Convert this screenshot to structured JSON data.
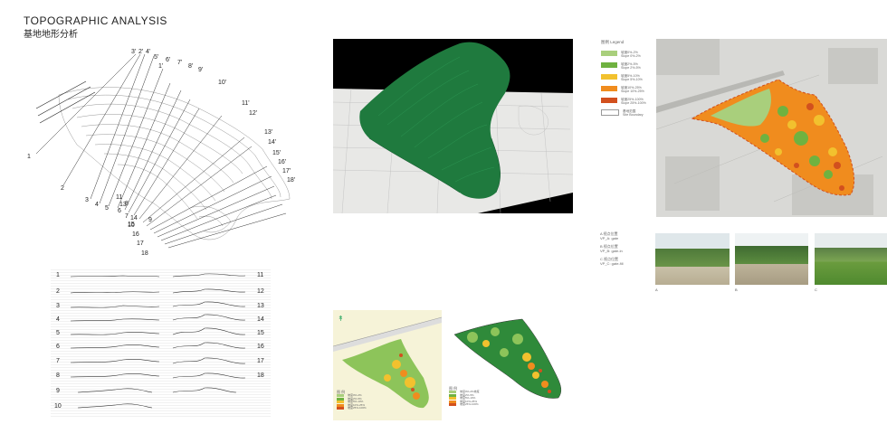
{
  "header": {
    "title": "TOPOGRAPHIC ANALYSIS",
    "subtitle": "基地地形分析"
  },
  "section_labels": {
    "top_primed": [
      "3'",
      "2'",
      "4'",
      "5'",
      "1'",
      "6'",
      "7'",
      "8'",
      "9'",
      "10'",
      "11'",
      "12'",
      "13'",
      "14'",
      "15'",
      "16'",
      "17'",
      "18'"
    ],
    "left_plain": [
      "1",
      "2",
      "3",
      "4",
      "5",
      "6",
      "7",
      "8",
      "9",
      "10",
      "11",
      "13",
      "14",
      "15",
      "16",
      "17",
      "18"
    ]
  },
  "profiles": {
    "left_numbers": [
      "1",
      "2",
      "3",
      "4",
      "5",
      "6",
      "7",
      "8",
      "9",
      "10"
    ],
    "right_numbers": [
      "11",
      "12",
      "13",
      "14",
      "15",
      "16",
      "17",
      "18"
    ]
  },
  "slope_legend": {
    "title": "图例  Legend",
    "items": [
      {
        "color": "#a9cf7c",
        "text": "坡度0%-2%\nSlope 0%-2%"
      },
      {
        "color": "#6fb240",
        "text": "坡度2%-5%\nSlope 2%-5%"
      },
      {
        "color": "#f2c12e",
        "text": "坡度5%-10%\nSlope 5%-10%"
      },
      {
        "color": "#f08c1e",
        "text": "坡度10%-25%\nSlope 10%-25%"
      },
      {
        "color": "#d2501e",
        "text": "坡度25%-100%\nSlope 25%-100%"
      },
      {
        "color": "#ffffff",
        "text": "基地范围\nSite Boundary"
      }
    ]
  },
  "photo_notes": {
    "a": "A  视点位置\nVP_A: gate",
    "b": "B  视点位置\nVP_B: gate-in",
    "c": "C  视点位置\nVP_C: gate-fill"
  },
  "photo_captions": [
    "A",
    "B",
    "C"
  ],
  "bottom_map_legend": {
    "title": "图 例",
    "items": [
      "坡度0%-2%",
      "坡度2%-5%",
      "坡度5%-10%",
      "坡度10%-25%",
      "坡度25%-100%"
    ]
  },
  "bottom_slope_legend": {
    "title": "图 例",
    "items": [
      "坡度0%-2%坡度",
      "坡度2%-5%",
      "坡度5%-10%",
      "坡度10%-25%",
      "坡度25%-100%"
    ]
  },
  "colors": {
    "model_green": "#1f7a3e",
    "model_background": "#000000",
    "slope_light_green": "#a9cf7c",
    "slope_green": "#6fb240",
    "slope_yellow": "#f2c12e",
    "slope_orange": "#f08c1e",
    "slope_red": "#d2501e"
  }
}
